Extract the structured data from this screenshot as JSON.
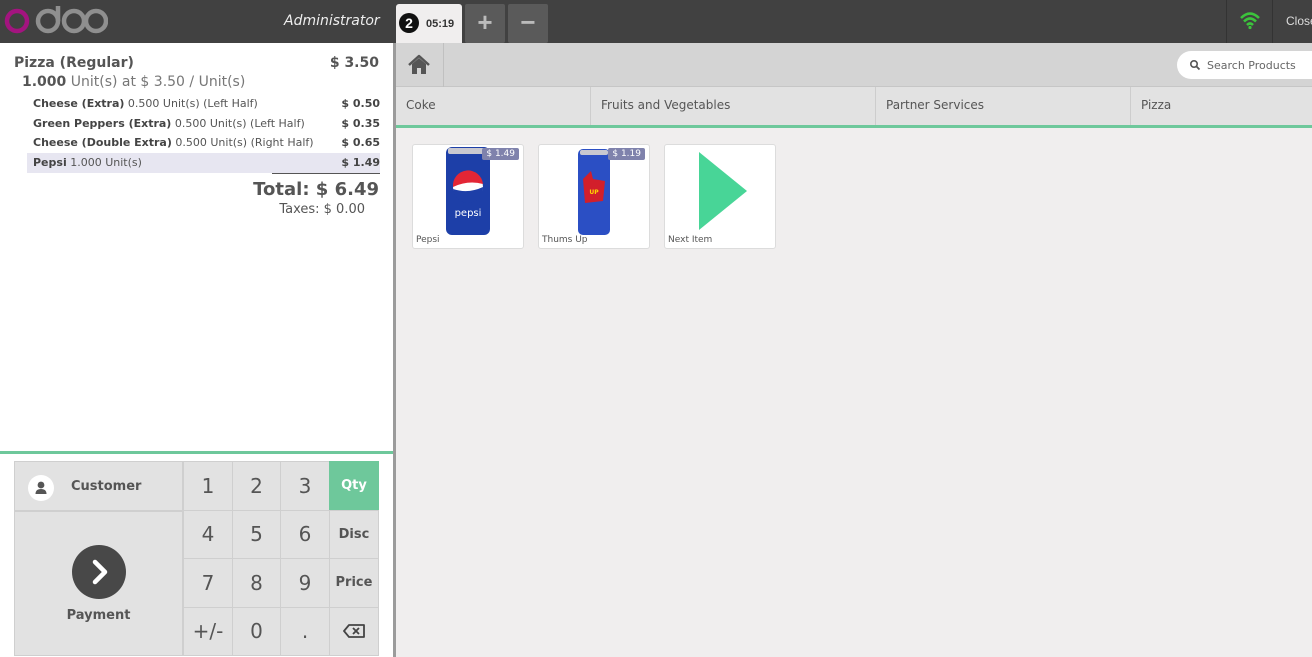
{
  "topbar": {
    "logo_text": "odoo",
    "user": "Administrator",
    "order_tab": {
      "number": "2",
      "time": "05:19"
    },
    "add_label": "+",
    "remove_label": "−",
    "close_label": "Close"
  },
  "order": {
    "main": {
      "name": "Pizza (Regular)",
      "price": "$ 3.50",
      "qty": "1.000",
      "qty_desc": " Unit(s) at $ 3.50 / Unit(s)"
    },
    "lines": [
      {
        "name": "Cheese (Extra)",
        "detail": " 0.500 Unit(s) (Left Half)",
        "price": "$ 0.50"
      },
      {
        "name": "Green Peppers (Extra)",
        "detail": " 0.500 Unit(s) (Left Half)",
        "price": "$ 0.35"
      },
      {
        "name": "Cheese (Double Extra)",
        "detail": " 0.500 Unit(s) (Right Half)",
        "price": "$ 0.65"
      },
      {
        "name": "Pepsi",
        "detail": " 1.000 Unit(s)",
        "price": "$ 1.49"
      }
    ],
    "total": "Total: $ 6.49",
    "taxes": "Taxes: $ 0.00"
  },
  "actions": {
    "customer": "Customer",
    "payment": "Payment"
  },
  "numpad": {
    "keys": [
      "1",
      "2",
      "3",
      "4",
      "5",
      "6",
      "7",
      "8",
      "9",
      "+/-",
      "0",
      "."
    ],
    "modes": [
      "Qty",
      "Disc",
      "Price"
    ],
    "active_mode": "Qty"
  },
  "search": {
    "placeholder": "Search Products"
  },
  "categories": [
    "Coke",
    "Fruits and Vegetables",
    "Partner Services",
    "Pizza"
  ],
  "products": [
    {
      "name": "Pepsi",
      "price": "$ 1.49"
    },
    {
      "name": "Thums Up",
      "price": "$ 1.19"
    },
    {
      "name": "Next Item",
      "price": ""
    }
  ],
  "colors": {
    "accent": "#6ec89b",
    "brand": "#a3147f",
    "topbar": "#414141",
    "price_tag": "#7f82ac",
    "wifi": "#3cc43c"
  }
}
